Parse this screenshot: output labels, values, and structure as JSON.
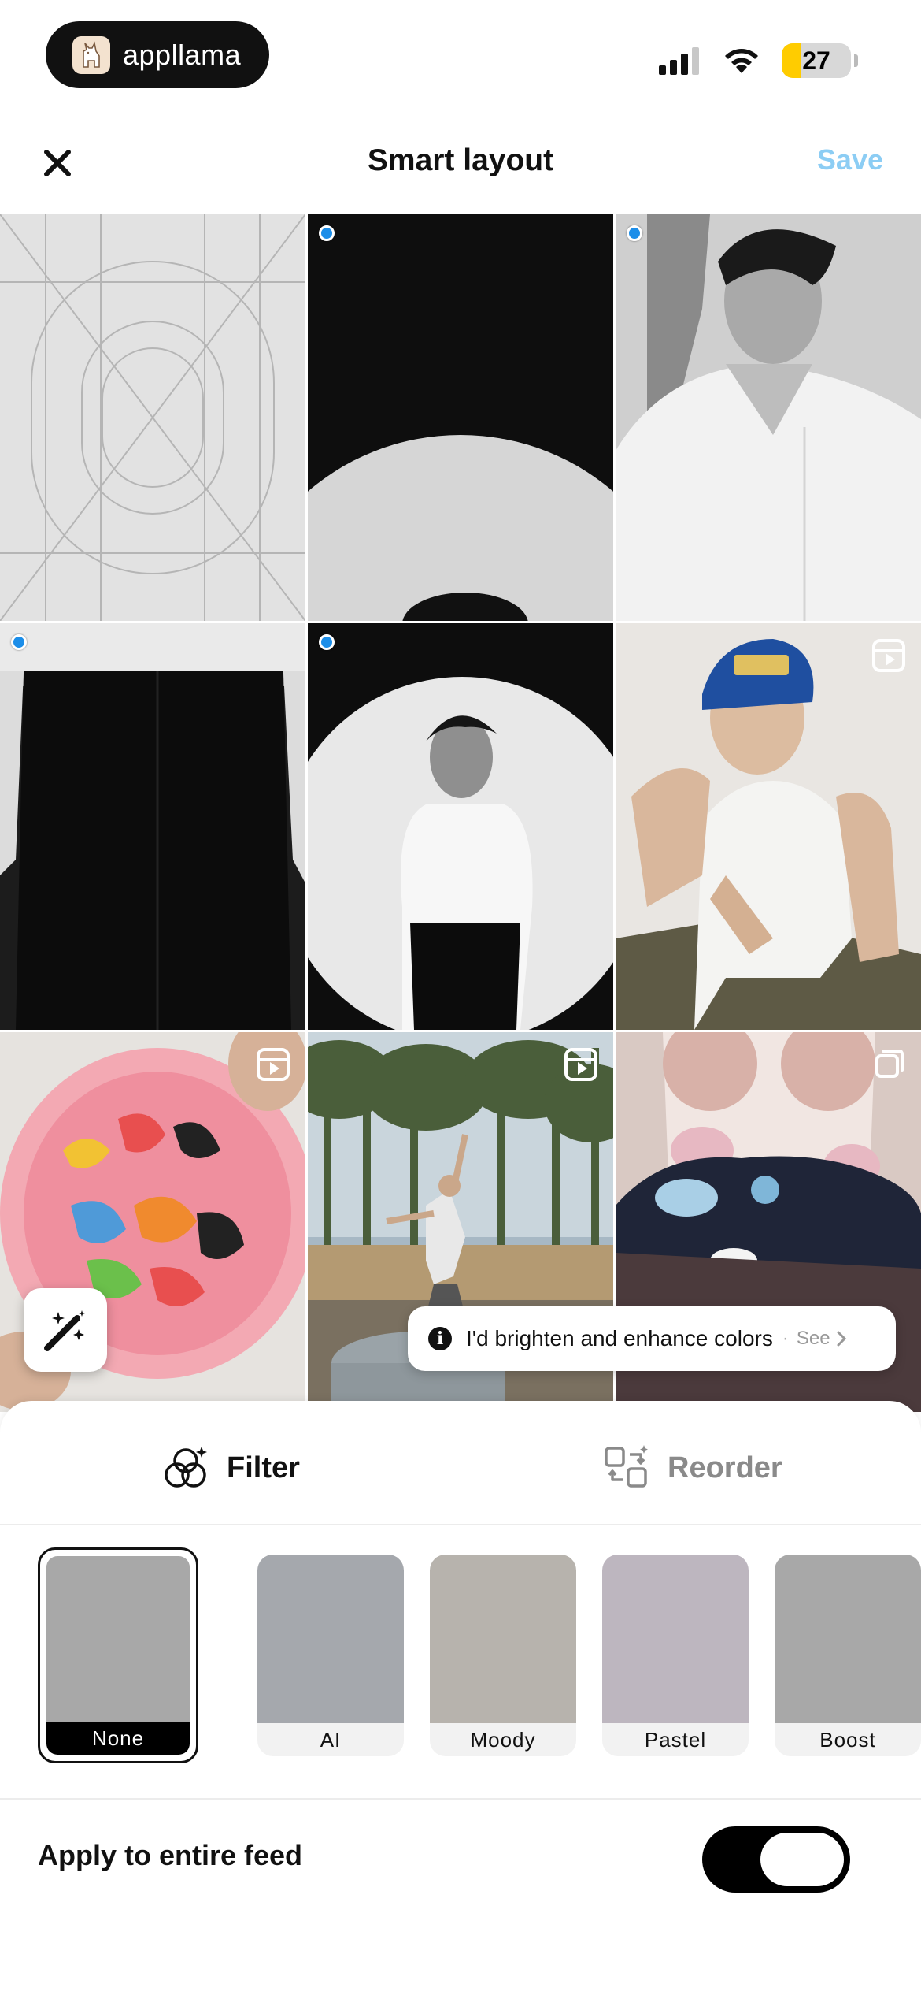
{
  "status_bar": {
    "app_name": "appllama",
    "battery_level": "27",
    "battery_fraction": 0.27
  },
  "header": {
    "title": "Smart layout",
    "save_label": "Save"
  },
  "grid": {
    "tiles": [
      {
        "kind": "placeholder",
        "selected": false,
        "badge": null
      },
      {
        "kind": "photo-spotlight-top",
        "selected": true,
        "badge": null
      },
      {
        "kind": "photo-portrait-profile",
        "selected": true,
        "badge": null
      },
      {
        "kind": "photo-trousers",
        "selected": true,
        "badge": null
      },
      {
        "kind": "photo-spotlight-figure",
        "selected": true,
        "badge": null
      },
      {
        "kind": "photo-cap-portrait",
        "selected": false,
        "badge": "reel-icon"
      },
      {
        "kind": "photo-candy-plate",
        "selected": false,
        "badge": "reel-icon"
      },
      {
        "kind": "photo-forest-jump",
        "selected": false,
        "badge": "reel-icon"
      },
      {
        "kind": "photo-orca-plush",
        "selected": false,
        "badge": "multi-photo-icon"
      }
    ]
  },
  "tooltip": {
    "text": "I'd brighten and enhance colors",
    "separator": "·",
    "see_label": "See"
  },
  "panel": {
    "tabs": [
      {
        "label": "Filter",
        "active": true,
        "icon": "filter-circles-icon"
      },
      {
        "label": "Reorder",
        "active": false,
        "icon": "reorder-icon"
      }
    ],
    "filters": [
      {
        "label": "None",
        "color": "#a8a8a8",
        "selected": true
      },
      {
        "label": "AI",
        "color": "#a5a8ad",
        "selected": false
      },
      {
        "label": "Moody",
        "color": "#b7b3ad",
        "selected": false
      },
      {
        "label": "Pastel",
        "color": "#bdb6bf",
        "selected": false
      },
      {
        "label": "Boost",
        "color": "#a8a8a8",
        "selected": false
      }
    ],
    "apply_label": "Apply to entire feed",
    "apply_enabled": true
  },
  "colors": {
    "accent_save": "#8ccdf4",
    "selection_dot": "#1c8ee9",
    "battery_fill": "#ffcc00"
  }
}
